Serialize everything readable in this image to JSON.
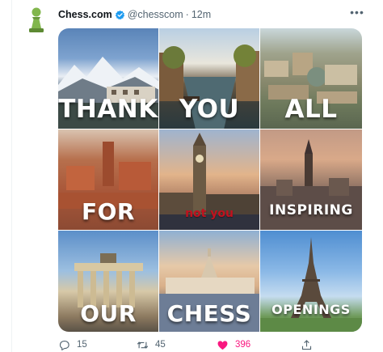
{
  "tweet": {
    "display_name": "Chess.com",
    "handle": "@chesscom",
    "separator": "·",
    "time": "12m",
    "more_label": "•••"
  },
  "image_grid": {
    "tiles": [
      {
        "word": "THANK"
      },
      {
        "word": "YOU"
      },
      {
        "word": "ALL"
      },
      {
        "word": "FOR"
      },
      {
        "word": "",
        "overlay": "not you"
      },
      {
        "word": "INSPIRING"
      },
      {
        "word": "OUR"
      },
      {
        "word": "CHESS"
      },
      {
        "word": "OPENINGS"
      }
    ]
  },
  "actions": {
    "replies": "15",
    "retweets": "45",
    "likes": "396"
  },
  "colors": {
    "verified": "#1d9bf0",
    "like": "#f91880",
    "secondary_text": "#536471",
    "chess_pawn": "#81b64c"
  },
  "icons": {
    "avatar": "chess-pawn-icon",
    "verified": "verified-badge-icon",
    "reply": "reply-icon",
    "retweet": "retweet-icon",
    "like": "heart-icon",
    "share": "share-icon"
  }
}
